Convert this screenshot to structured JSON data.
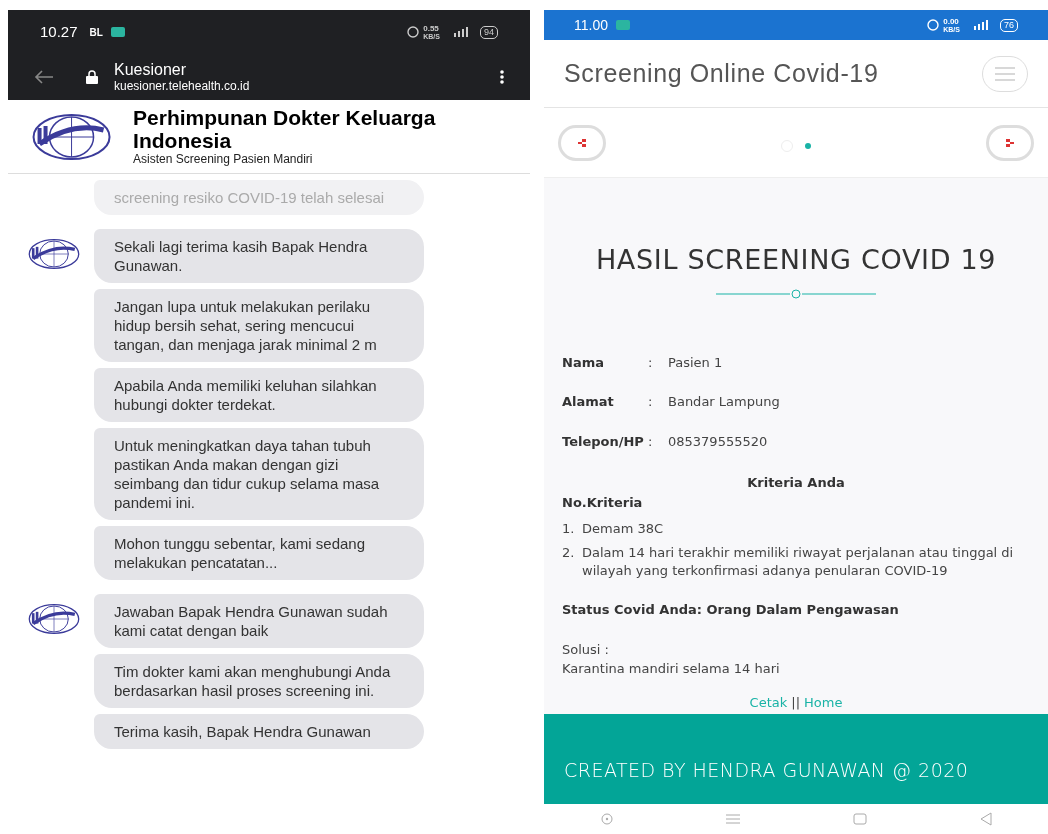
{
  "left_phone": {
    "status_bar": {
      "time": "10.27",
      "carrier": "BL",
      "speed": "0.55",
      "speed_unit": "KB/S",
      "battery": "94"
    },
    "browser_bar": {
      "title": "Kuesioner",
      "url": "kuesioner.telehealth.co.id"
    },
    "header": {
      "title": "Perhimpunan Dokter Keluarga Indonesia",
      "subtitle": "Asisten Screening Pasien Mandiri"
    },
    "chat_groups": [
      {
        "avatar": false,
        "faded": true,
        "messages": [
          "screening resiko COVID-19 telah selesai"
        ]
      },
      {
        "avatar": true,
        "faded": false,
        "messages": [
          "Sekali lagi terima kasih Bapak Hendra Gunawan.",
          "Jangan lupa untuk melakukan perilaku hidup bersih sehat, sering mencucui tangan, dan menjaga jarak minimal 2 m",
          "Apabila Anda memiliki keluhan silahkan hubungi dokter terdekat.",
          "Untuk meningkatkan daya tahan tubuh pastikan Anda makan dengan gizi seimbang dan tidur cukup selama masa pandemi ini.",
          "Mohon tunggu sebentar, kami sedang melakukan pencatatan..."
        ]
      },
      {
        "avatar": true,
        "faded": false,
        "messages": [
          "Jawaban Bapak Hendra Gunawan sudah kami catat dengan baik",
          "Tim dokter kami akan menghubungi Anda berdasarkan hasil proses screening ini.",
          "Terima kasih, Bapak Hendra Gunawan"
        ]
      }
    ]
  },
  "right_phone": {
    "status_bar": {
      "time": "11.00",
      "speed": "0.00",
      "speed_unit": "KB/S",
      "battery": "76"
    },
    "navbar": {
      "brand": "Screening Online Covid-19"
    },
    "carousel": {
      "dots": [
        {
          "selected": false
        },
        {
          "selected": true
        }
      ]
    },
    "result": {
      "title": "HASIL SCREENING COVID 19",
      "fields": [
        {
          "label": "Nama",
          "separator": ":",
          "value": "Pasien 1"
        },
        {
          "label": "Alamat",
          "separator": ":",
          "value": "Bandar Lampung"
        },
        {
          "label": "Telepon/HP",
          "separator": ":",
          "value": "085379555520"
        }
      ],
      "criteria_heading": "Kriteria Anda",
      "criteria_column": "No.Kriteria",
      "criteria": [
        {
          "number": "1.",
          "text": "Demam 38C"
        },
        {
          "number": "2.",
          "text": "Dalam 14 hari terakhir memiliki riwayat perjalanan atau tinggal di wilayah yang terkonfirmasi adanya penularan COVID-19"
        }
      ],
      "status": "Status Covid Anda: Orang Dalam Pengawasan",
      "solution_label": "Solusi :",
      "solution": "Karantina mandiri selama 14 hari",
      "links": [
        "Cetak",
        "||",
        "Home"
      ]
    },
    "footer": "CREATED BY HENDRA GUNAWAN @ 2020"
  }
}
